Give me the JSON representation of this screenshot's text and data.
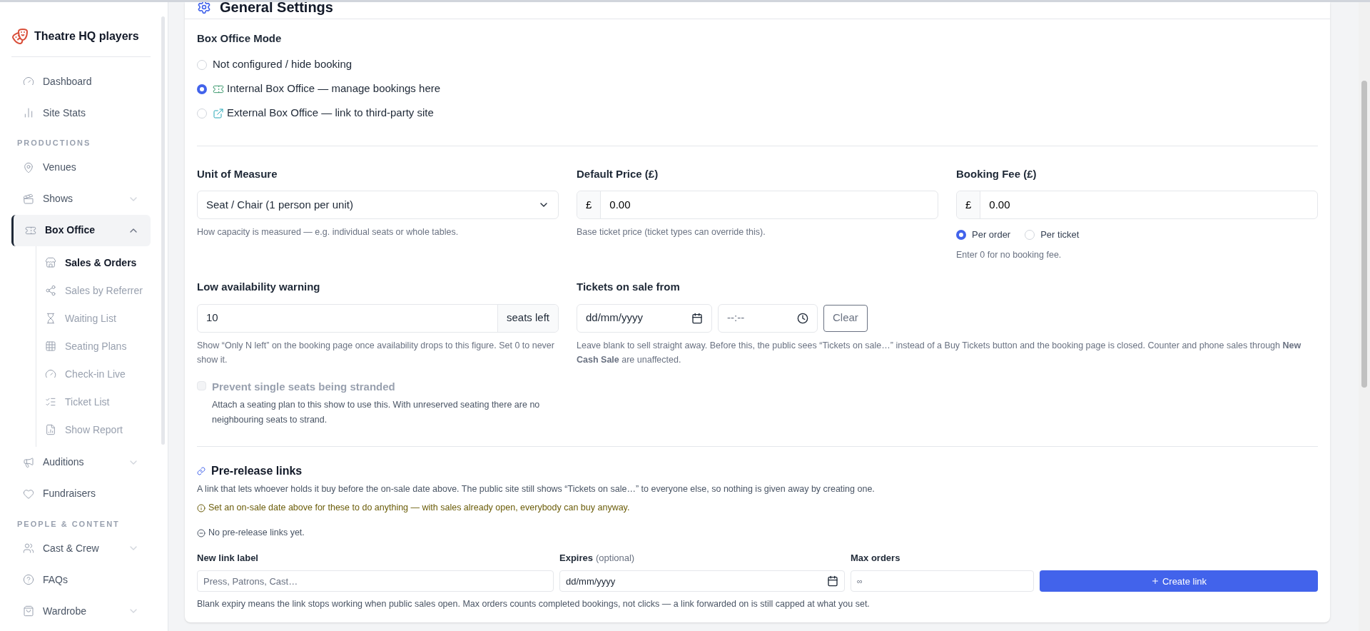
{
  "sidebar": {
    "brand": "Theatre HQ players",
    "items": [
      {
        "kind": "link",
        "label": "Dashboard"
      },
      {
        "kind": "link",
        "label": "Site Stats"
      },
      {
        "kind": "section",
        "label": "PRODUCTIONS"
      },
      {
        "kind": "link",
        "label": "Venues"
      },
      {
        "kind": "group",
        "label": "Shows",
        "expanded": false,
        "selected": false
      },
      {
        "kind": "group",
        "label": "Box Office",
        "expanded": true,
        "selected": true,
        "children": [
          {
            "label": "Sales & Orders",
            "selected": true
          },
          {
            "label": "Sales by Referrer",
            "selected": false
          },
          {
            "label": "Waiting List",
            "selected": false
          },
          {
            "label": "Seating Plans",
            "selected": false
          },
          {
            "label": "Check-in Live",
            "selected": false
          },
          {
            "label": "Ticket List",
            "selected": false
          },
          {
            "label": "Show Report",
            "selected": false
          }
        ]
      },
      {
        "kind": "group",
        "label": "Auditions",
        "expanded": false,
        "selected": false
      },
      {
        "kind": "link",
        "label": "Fundraisers"
      },
      {
        "kind": "section",
        "label": "PEOPLE & CONTENT"
      },
      {
        "kind": "group",
        "label": "Cast & Crew",
        "expanded": false,
        "selected": false
      },
      {
        "kind": "link",
        "label": "FAQs"
      },
      {
        "kind": "group",
        "label": "Wardrobe",
        "expanded": false,
        "selected": false
      }
    ]
  },
  "general_settings": {
    "title": "General Settings",
    "box_office_mode": {
      "label": "Box Office Mode",
      "options": [
        {
          "label": "Not configured / hide booking",
          "selected": false
        },
        {
          "label": "Internal Box Office — manage bookings here",
          "selected": true
        },
        {
          "label": "External Box Office — link to third-party site",
          "selected": false
        }
      ]
    },
    "unit_of_measure": {
      "label": "Unit of Measure",
      "value": "Seat / Chair (1 person per unit)",
      "help": "How capacity is measured — e.g. individual seats or whole tables."
    },
    "default_price": {
      "label": "Default Price (£)",
      "prefix": "£",
      "value": "0.00",
      "help": "Base ticket price (ticket types can override this)."
    },
    "booking_fee": {
      "label": "Booking Fee (£)",
      "prefix": "£",
      "value": "0.00",
      "options": [
        {
          "label": "Per order",
          "selected": true
        },
        {
          "label": "Per ticket",
          "selected": false
        }
      ],
      "help": "Enter 0 for no booking fee."
    },
    "low_availability": {
      "label": "Low availability warning",
      "value": "10",
      "suffix": "seats left",
      "help": "Show “Only N left” on the booking page once availability drops to this figure. Set 0 to never show it."
    },
    "prevent_stranded": {
      "label": "Prevent single seats being stranded",
      "checked": false,
      "disabled": true,
      "help": "Attach a seating plan to this show to use this. With unreserved seating there are no neighbouring seats to strand."
    },
    "on_sale_from": {
      "label": "Tickets on sale from",
      "date_placeholder": "dd/mm/yyyy",
      "time_placeholder": "--:--",
      "clear_button": "Clear",
      "help": "Leave blank to sell straight away. Before this, the public sees “Tickets on sale…” instead of a Buy Tickets button and the booking page is closed. Counter and phone sales through **New Cash Sale** are unaffected."
    }
  },
  "pre_release_links": {
    "title": "Pre-release links",
    "description": "A link that lets whoever holds it buy before the on-sale date above. The public site still shows “Tickets on sale…” to everyone else, so nothing is given away by creating one.",
    "warning": "Set an on-sale date above for these to do anything — with sales already open, everybody can buy anyway.",
    "empty": "No pre-release links yet.",
    "label_field": {
      "label": "New link label",
      "placeholder": "Press, Patrons, Cast…"
    },
    "expires_field": {
      "label": "Expires",
      "note": "(optional)",
      "placeholder": "dd/mm/yyyy"
    },
    "max_orders_field": {
      "label": "Max orders",
      "placeholder": "∞"
    },
    "create_button": "Create link",
    "help": "Blank expiry means the link stops working when public sales open. Max orders counts completed bookings, not clicks — a link forwarded on is still capped at what you set."
  }
}
